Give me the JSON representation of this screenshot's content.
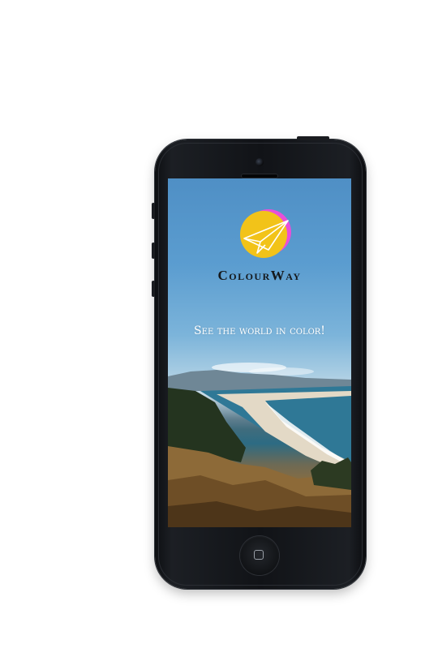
{
  "app": {
    "name": "ColourWay",
    "tagline": "See the world in color!"
  },
  "icons": {
    "logo": "paper-plane-logo-icon",
    "home": "home-button-icon"
  },
  "colors": {
    "logo_yellow": "#f2c319",
    "logo_magenta": "#e84fd9",
    "brand_text": "#15191d",
    "tagline_text": "#ffffff"
  }
}
